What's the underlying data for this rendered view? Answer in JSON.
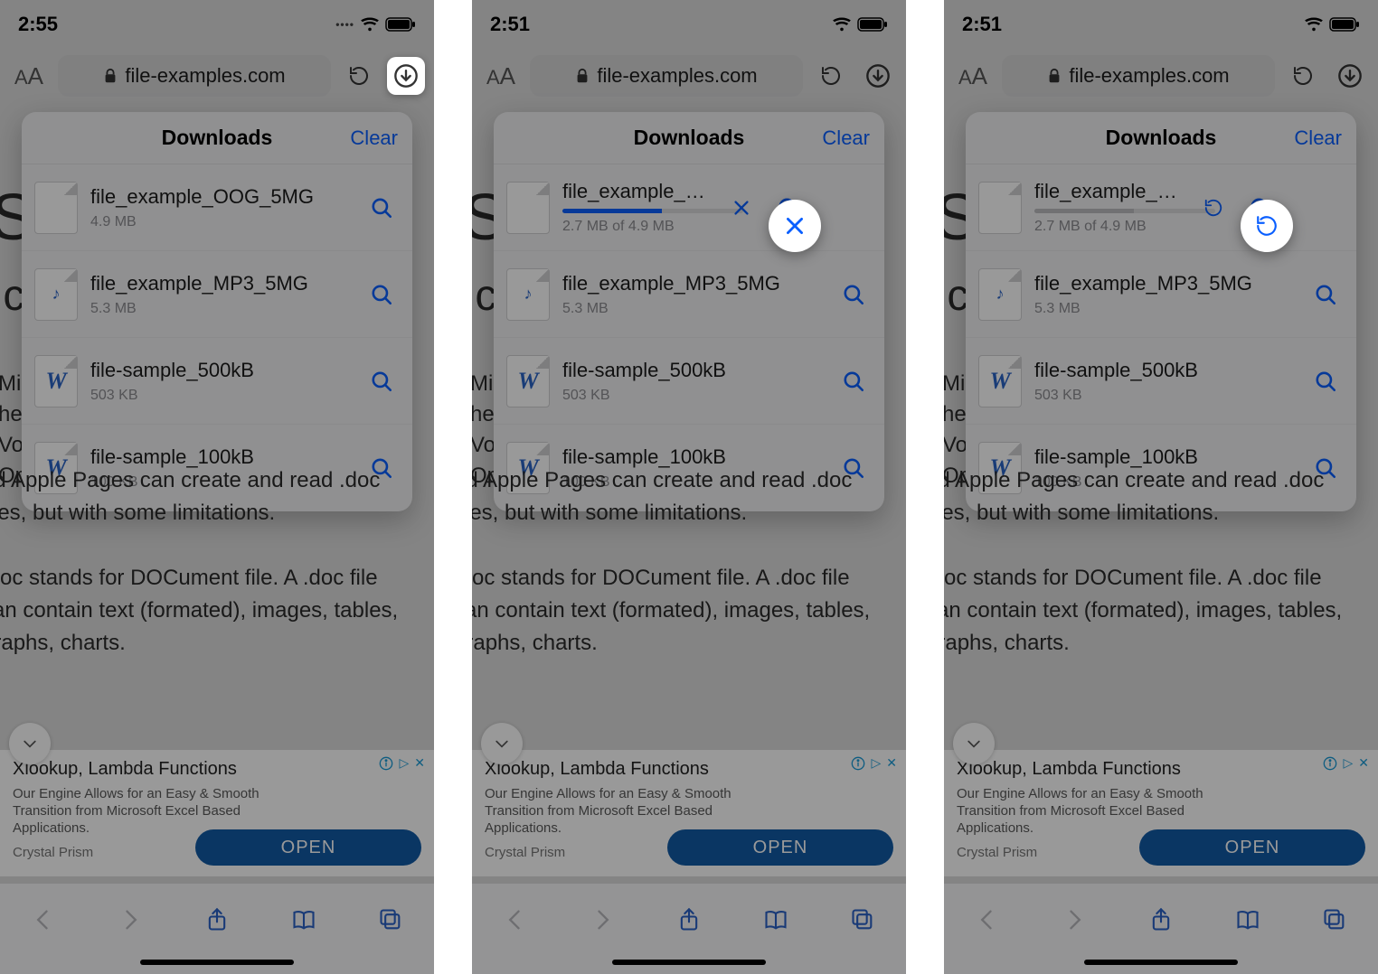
{
  "panes": [
    {
      "time": "2:55",
      "highlight": "downloads-button",
      "first_item": {
        "name": "file_example_OOG_5MG",
        "sub": "4.9 MB",
        "state": "done"
      }
    },
    {
      "time": "2:51",
      "highlight": "cancel",
      "first_item": {
        "name": "file_example_OOG...",
        "sub": "2.7 MB of 4.9 MB",
        "state": "downloading",
        "progress": 55
      }
    },
    {
      "time": "2:51",
      "highlight": "retry",
      "first_item": {
        "name": "file_example_OOG...",
        "sub": "2.7 MB of 4.9 MB",
        "state": "paused",
        "progress": 55
      }
    }
  ],
  "url_host": "file-examples.com",
  "downloads_title": "Downloads",
  "clear_label": "Clear",
  "other_items": [
    {
      "name": "file_example_MP3_5MG",
      "sub": "5.3 MB",
      "icon": "audio"
    },
    {
      "name": "file-sample_500kB",
      "sub": "503 KB",
      "icon": "word"
    },
    {
      "name": "file-sample_100kB",
      "sub": "100 KB",
      "icon": "word"
    }
  ],
  "bg_side": "Mic\nhe\nVo\nOpe",
  "bg_para1": "nd Apple Pages can create and read .doc files, but with some limitations.",
  "bg_para2": ".doc stands for DOCument file. A .doc file can contain text (formated), images, tables, graphs, charts.",
  "ad": {
    "headline": "Xlookup, Lambda Functions",
    "sub": "Our Engine Allows for an Easy & Smooth Transition from Microsoft Excel Based Applications.",
    "brand": "Crystal Prism",
    "cta": "OPEN"
  }
}
